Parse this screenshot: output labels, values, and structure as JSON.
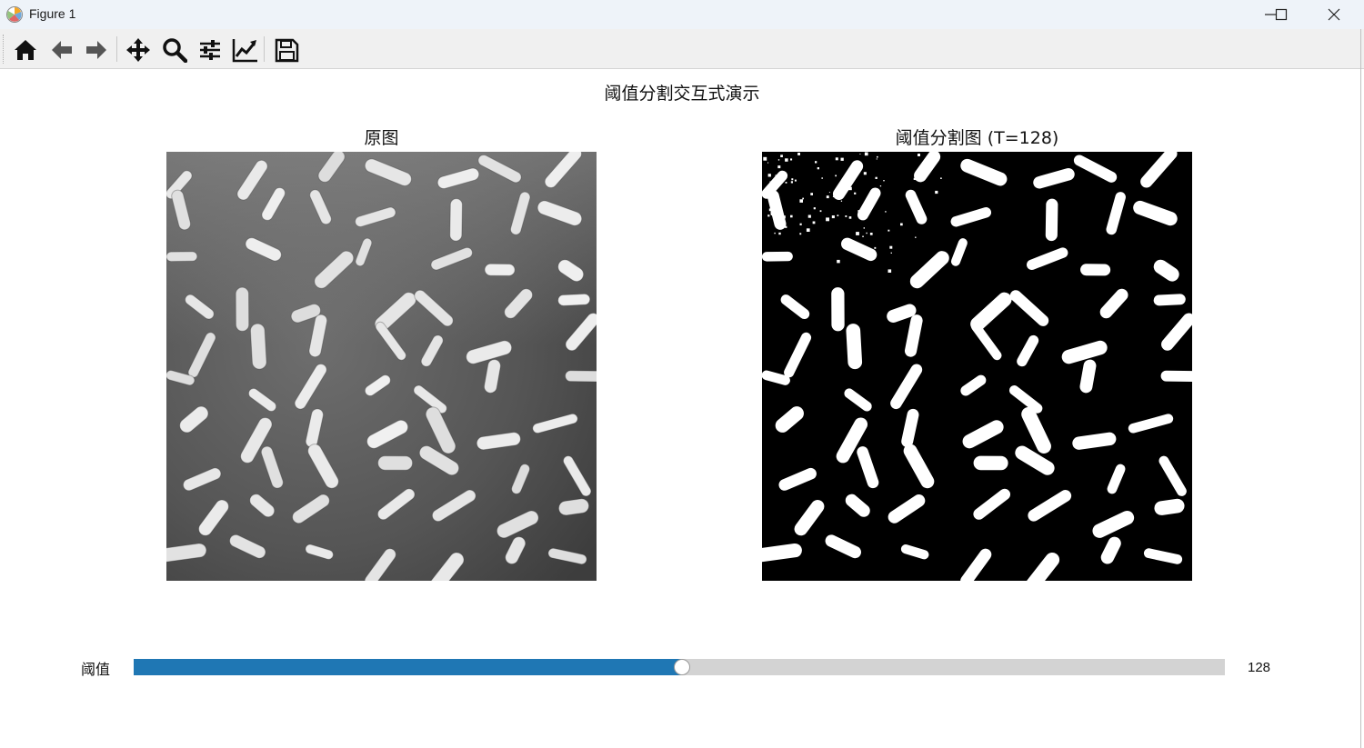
{
  "window": {
    "title": "Figure 1",
    "controls": [
      "minimize-icon",
      "maximize-icon",
      "close-icon"
    ]
  },
  "toolbar": {
    "buttons": [
      {
        "icon": "home-icon",
        "tooltip": "Reset original view"
      },
      {
        "icon": "back-arrow-icon",
        "tooltip": "Back to previous view"
      },
      {
        "icon": "forward-arrow-icon",
        "tooltip": "Forward to next view"
      },
      {
        "icon": "pan-icon",
        "tooltip": "Pan axes"
      },
      {
        "icon": "zoom-icon",
        "tooltip": "Zoom to rectangle"
      },
      {
        "icon": "subplots-icon",
        "tooltip": "Configure subplots"
      },
      {
        "icon": "edit-axis-icon",
        "tooltip": "Edit axis, curve and image parameters"
      },
      {
        "icon": "save-icon",
        "tooltip": "Save the figure"
      }
    ]
  },
  "figure": {
    "suptitle": "阈值分割交互式演示",
    "axes": [
      {
        "title": "原图",
        "image": "grayscale rice grains"
      },
      {
        "title": "阈值分割图 (T=128)",
        "image": "binary thresholded rice grains"
      }
    ]
  },
  "slider": {
    "label": "阈值",
    "value": 128,
    "value_text": "128",
    "min": 0,
    "max": 255,
    "fill_color": "#1f77b4",
    "track_color": "#d3d3d3"
  }
}
